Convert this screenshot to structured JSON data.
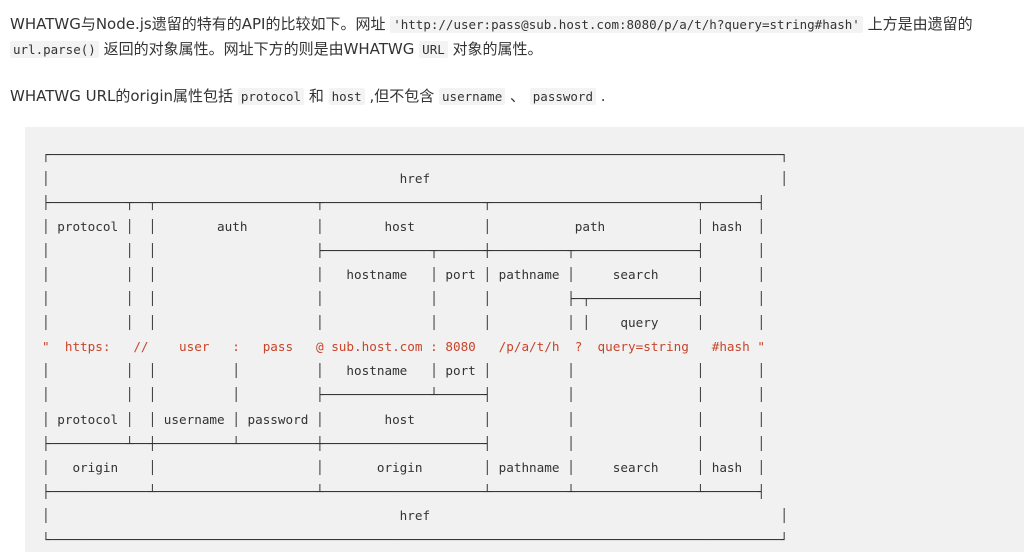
{
  "intro": {
    "text1": "WHATWG与Node.js遗留的特有的API的比较如下。网址 ",
    "url_example": "'http://user:pass@sub.host.com:8080/p/a/t/h?query=string#hash'",
    "text2": " 上方是由遗留的 ",
    "code_parse": "url.parse()",
    "text3": " 返回的对象属性。网址下方的则是由WHATWG ",
    "code_url": "URL",
    "text4": " 对象的属性。"
  },
  "origin_note": {
    "text1": "WHATWG URL的origin属性包括 ",
    "code_protocol": "protocol",
    "text2": " 和 ",
    "code_host": "host",
    "text3": " ,但不包含 ",
    "code_username": "username",
    "text4": " 、 ",
    "code_password": "password",
    "text5": " ."
  },
  "diagram": {
    "lines_top": [
      "┌────────────────────────────────────────────────────────────────────────────────────────────────┐",
      "│                                              href                                              │",
      "├──────────┬──┬─────────────────────┬─────────────────────┬───────────────────────────┬───────┤",
      "│ protocol │  │        auth         │        host         │           path            │ hash  │",
      "│          │  │                     ├──────────────┬──────┼──────────┬────────────────┤       │",
      "│          │  │                     │   hostname   │ port │ pathname │     search     │       │",
      "│          │  │                     │              │      │          ├─┬──────────────┤       │",
      "│          │  │                     │              │      │          │ │    query     │       │"
    ],
    "url_line": "\"  https:   //    user   :   pass   @ sub.host.com : 8080   /p/a/t/h  ?  query=string   #hash \"",
    "lines_bottom": [
      "│          │  │          │          │   hostname   │ port │          │                │       │",
      "│          │  │          │          ├──────────────┴──────┤          │                │       │",
      "│ protocol │  │ username │ password │        host         │          │                │       │",
      "├──────────┴──┼──────────┴──────────┼─────────────────────┤          │                │       │",
      "│   origin    │                     │       origin        │ pathname │     search     │ hash  │",
      "├─────────────┴─────────────────────┴─────────────────────┴──────────┴────────────────┴───────┤",
      "│                                              href                                              │",
      "└────────────────────────────────────────────────────────────────────────────────────────────────┘"
    ]
  }
}
